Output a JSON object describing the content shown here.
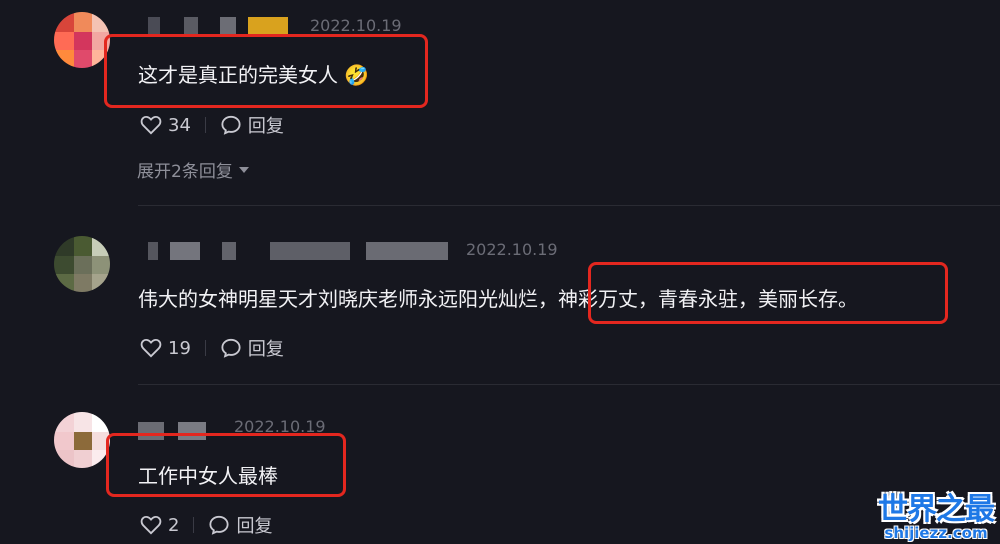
{
  "comments": [
    {
      "date": "2022.10.19",
      "text": "这才是真正的完美女人 🤣",
      "likes": "34",
      "reply_label": "回复",
      "expand_label": "展开2条回复"
    },
    {
      "date": "2022.10.19",
      "text": "伟大的女神明星天才刘晓庆老师永远阳光灿烂，神彩万丈，青春永驻，美丽长存。",
      "likes": "19",
      "reply_label": "回复"
    },
    {
      "date": "2022.10.19",
      "text": "工作中女人最棒",
      "likes": "2",
      "reply_label": "回复"
    }
  ],
  "watermark": {
    "title": "世界之最",
    "url": "shijiezz.com"
  },
  "colors": {
    "background": "#16171f",
    "highlight": "#e3271f",
    "watermark": "#1e78e6"
  }
}
